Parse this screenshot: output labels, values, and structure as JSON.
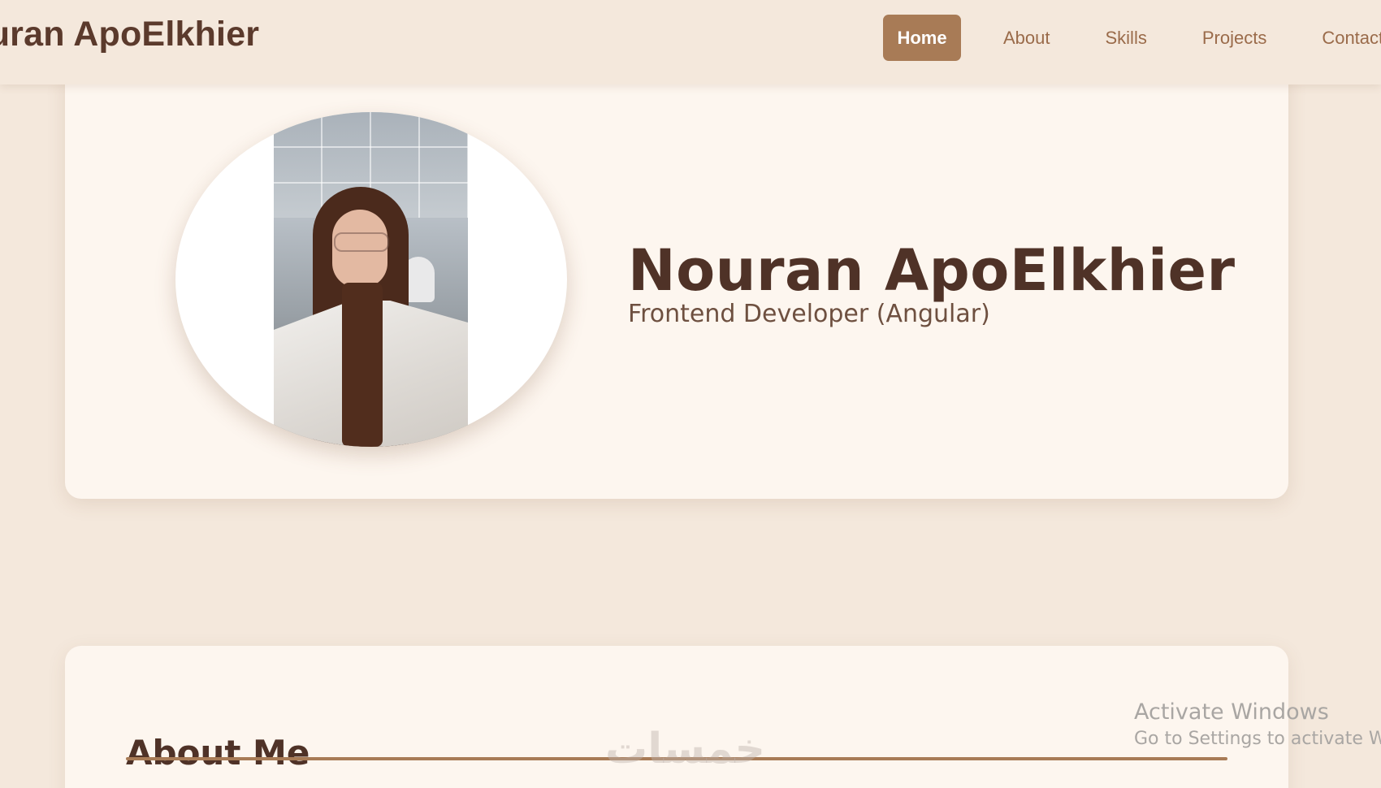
{
  "header": {
    "brand": "Nouran ApoElkhier",
    "nav": [
      {
        "label": "Home",
        "active": true
      },
      {
        "label": "About",
        "active": false
      },
      {
        "label": "Skills",
        "active": false
      },
      {
        "label": "Projects",
        "active": false
      },
      {
        "label": "Contact",
        "active": false
      }
    ]
  },
  "hero": {
    "name": "Nouran ApoElkhier",
    "role": "Frontend Developer (Angular)"
  },
  "about": {
    "title": "About Me"
  },
  "overlays": {
    "watermark": "خمسات",
    "activate_title": "Activate Windows",
    "activate_sub": "Go to Settings to activate Windows."
  },
  "colors": {
    "background": "#f4e8dc",
    "card": "#fdf6ef",
    "accent": "#a87b56",
    "heading": "#4f3227",
    "nav_text": "#9a6b4a"
  }
}
